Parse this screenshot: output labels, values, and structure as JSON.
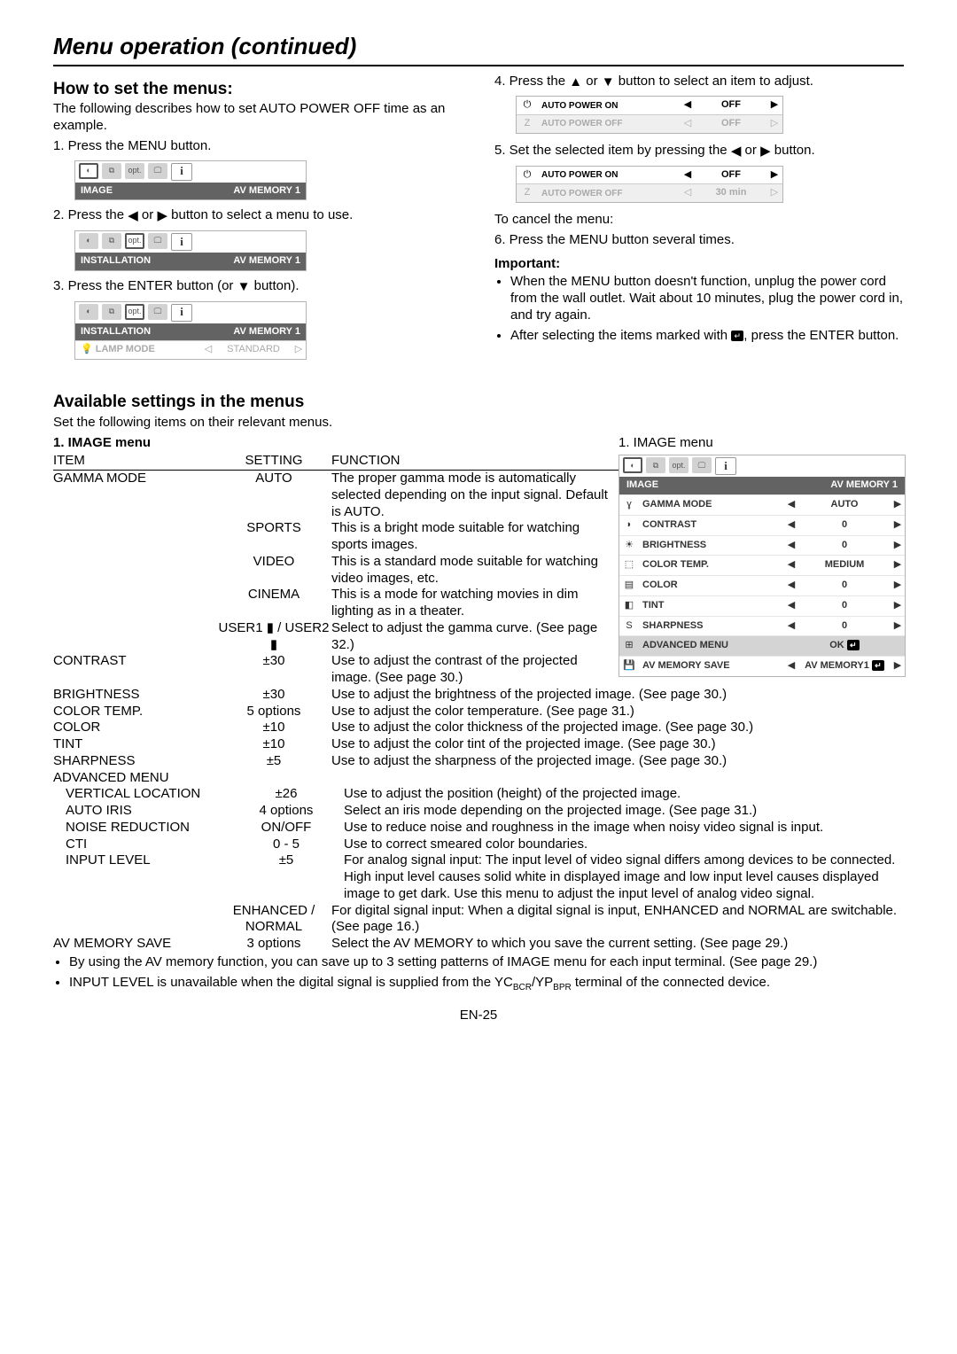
{
  "header": {
    "title": "Menu operation (continued)"
  },
  "left": {
    "h2": "How to set the menus:",
    "intro": "The following describes how to set AUTO POWER OFF time as an example.",
    "step1": "1.  Press the MENU button.",
    "strip1": {
      "title_left": "IMAGE",
      "title_right": "AV MEMORY 1",
      "opt": "opt.",
      "info": "i"
    },
    "step2_a": "2.  Press the ",
    "step2_b": " or ",
    "step2_c": " button to select a menu to use.",
    "strip2": {
      "title_left": "INSTALLATION",
      "title_right": "AV MEMORY 1",
      "opt": "opt.",
      "info": "i"
    },
    "step3_a": "3.  Press the ENTER button (or ",
    "step3_b": " button).",
    "strip3": {
      "title_left": "INSTALLATION",
      "title_right": "AV MEMORY 1",
      "opt": "opt.",
      "info": "i",
      "item_label": "LAMP MODE",
      "item_value": "STANDARD"
    }
  },
  "right": {
    "step4_a": "4.  Press the ",
    "step4_b": " or ",
    "step4_c": " button to select an item to adjust.",
    "mini1": {
      "r1": {
        "label": "AUTO POWER ON",
        "value": "OFF"
      },
      "r2": {
        "label": "AUTO POWER OFF",
        "value": "OFF"
      }
    },
    "step5_a": "5.  Set the selected item by pressing the ",
    "step5_b": " or ",
    "step5_c": " button.",
    "mini2": {
      "r1": {
        "label": "AUTO POWER ON",
        "value": "OFF"
      },
      "r2": {
        "label": "AUTO POWER OFF",
        "value": "30 min"
      }
    },
    "cancel_label": "To cancel the menu:",
    "step6": "6.  Press the MENU button several times.",
    "important_h": "Important:",
    "imp1": "When the MENU button doesn't function, unplug the power cord from the wall outlet. Wait about 10 minutes, plug the power cord in, and try again.",
    "imp2_a": "After selecting the items marked with ",
    "imp2_b": ", press the ENTER button."
  },
  "avail": {
    "h2": "Available settings in the menus",
    "sub": "Set the following items on their relevant menus.",
    "menu_h": "1. IMAGE menu",
    "right_title": "1. IMAGE menu",
    "hdr_item": "ITEM",
    "hdr_set": "SETTING",
    "hdr_fun": "FUNCTION",
    "img_menu": {
      "opt": "opt.",
      "info": "i",
      "title_left": "IMAGE",
      "title_right": "AV MEMORY 1",
      "rows": [
        {
          "label": "GAMMA MODE",
          "value": "AUTO"
        },
        {
          "label": "CONTRAST",
          "value": "0"
        },
        {
          "label": "BRIGHTNESS",
          "value": "0"
        },
        {
          "label": "COLOR TEMP.",
          "value": "MEDIUM"
        },
        {
          "label": "COLOR",
          "value": "0"
        },
        {
          "label": "TINT",
          "value": "0"
        },
        {
          "label": "SHARPNESS",
          "value": "0"
        }
      ],
      "adv_label": "ADVANCED MENU",
      "adv_value": "OK",
      "save_label": "AV MEMORY SAVE",
      "save_value": "AV MEMORY1"
    }
  },
  "table_top": {
    "gm_item": "GAMMA MODE",
    "gm_auto": "AUTO",
    "gm_auto_fun": "The proper gamma mode is automatically selected depending on the input signal. Default is AUTO.",
    "gm_sports": "SPORTS",
    "gm_sports_fun": "This is a bright mode suitable for watching sports images.",
    "gm_video": "VIDEO",
    "gm_video_fun": "This is a standard mode suitable for watching video images, etc.",
    "gm_cinema": "CINEMA",
    "gm_cinema_fun": "This is a mode for watching movies in dim lighting as in a theater.",
    "gm_user": "USER1 ▮ / USER2 ▮",
    "gm_user_fun": "Select to adjust the gamma curve. (See page 32.)",
    "contrast_item": "CONTRAST",
    "contrast_set": "±30",
    "contrast_fun": "Use to adjust the contrast of the projected image. (See page 30.)"
  },
  "table_rows": [
    {
      "item": "BRIGHTNESS",
      "setting": "±30",
      "fun": "Use to adjust the brightness of the projected image. (See page 30.)"
    },
    {
      "item": "COLOR TEMP.",
      "setting": "5 options",
      "fun": "Use to adjust the color temperature. (See page 31.)"
    },
    {
      "item": "COLOR",
      "setting": "±10",
      "fun": "Use to adjust the color thickness of the projected image. (See page 30.)"
    },
    {
      "item": "TINT",
      "setting": "±10",
      "fun": "Use to adjust the color tint of the projected image. (See page 30.)"
    },
    {
      "item": "SHARPNESS",
      "setting": "±5",
      "fun": "Use to adjust the sharpness of the projected image. (See page 30.)"
    },
    {
      "item": "ADVANCED MENU",
      "setting": "",
      "fun": ""
    },
    {
      "item": "VERTICAL LOCATION",
      "setting": "±26",
      "fun": "Use to adjust the position (height) of the projected image.",
      "indent": true
    },
    {
      "item": "AUTO IRIS",
      "setting": "4 options",
      "fun": "Select an iris mode depending on the projected image. (See page 31.)",
      "indent": true
    },
    {
      "item": "NOISE REDUCTION",
      "setting": "ON/OFF",
      "fun": "Use to reduce noise and roughness in the image when noisy video signal is input.",
      "indent": true
    },
    {
      "item": "CTI",
      "setting": "0 - 5",
      "fun": "Use to correct smeared color boundaries.",
      "indent": true
    },
    {
      "item": "INPUT LEVEL",
      "setting": "±5",
      "fun": "For analog signal input: The input level of video signal differs among devices to be connected. High input level causes solid white in displayed image and low input level causes displayed image to get dark. Use this menu to adjust the input level of analog video signal.",
      "indent": true
    },
    {
      "item": "",
      "setting": "ENHANCED / NORMAL",
      "fun": "For digital signal input: When a digital signal is input, ENHANCED and NORMAL are switchable. (See page 16.)"
    },
    {
      "item": "AV MEMORY SAVE",
      "setting": "3 options",
      "fun": "Select the AV MEMORY to which you save the current setting. (See page 29.)"
    }
  ],
  "notes": {
    "n1": "By using the AV memory function, you can save up to 3 setting patterns of IMAGE menu for each input terminal. (See page 29.)",
    "n2_a": "INPUT LEVEL is unavailable when the digital signal is supplied from the YC",
    "n2_b": "/YP",
    "n2_c": " terminal of the connected device.",
    "sub_bcr": "BCR",
    "sub_bpr": "BPR"
  },
  "footer": "EN-25",
  "glyph": {
    "left": "◀",
    "right": "▶",
    "up": "▲",
    "down": "▼",
    "left_g": "◁",
    "right_g": "▷"
  }
}
